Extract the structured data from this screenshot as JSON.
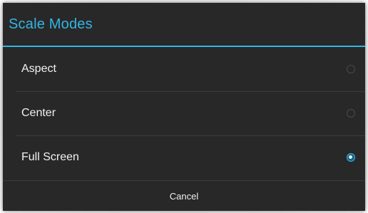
{
  "dialog": {
    "title": "Scale Modes",
    "accent_color": "#33b5e5",
    "background_color": "#282828",
    "options": [
      {
        "label": "Aspect",
        "selected": false
      },
      {
        "label": "Center",
        "selected": false
      },
      {
        "label": "Full Screen",
        "selected": true
      }
    ],
    "cancel_label": "Cancel"
  }
}
